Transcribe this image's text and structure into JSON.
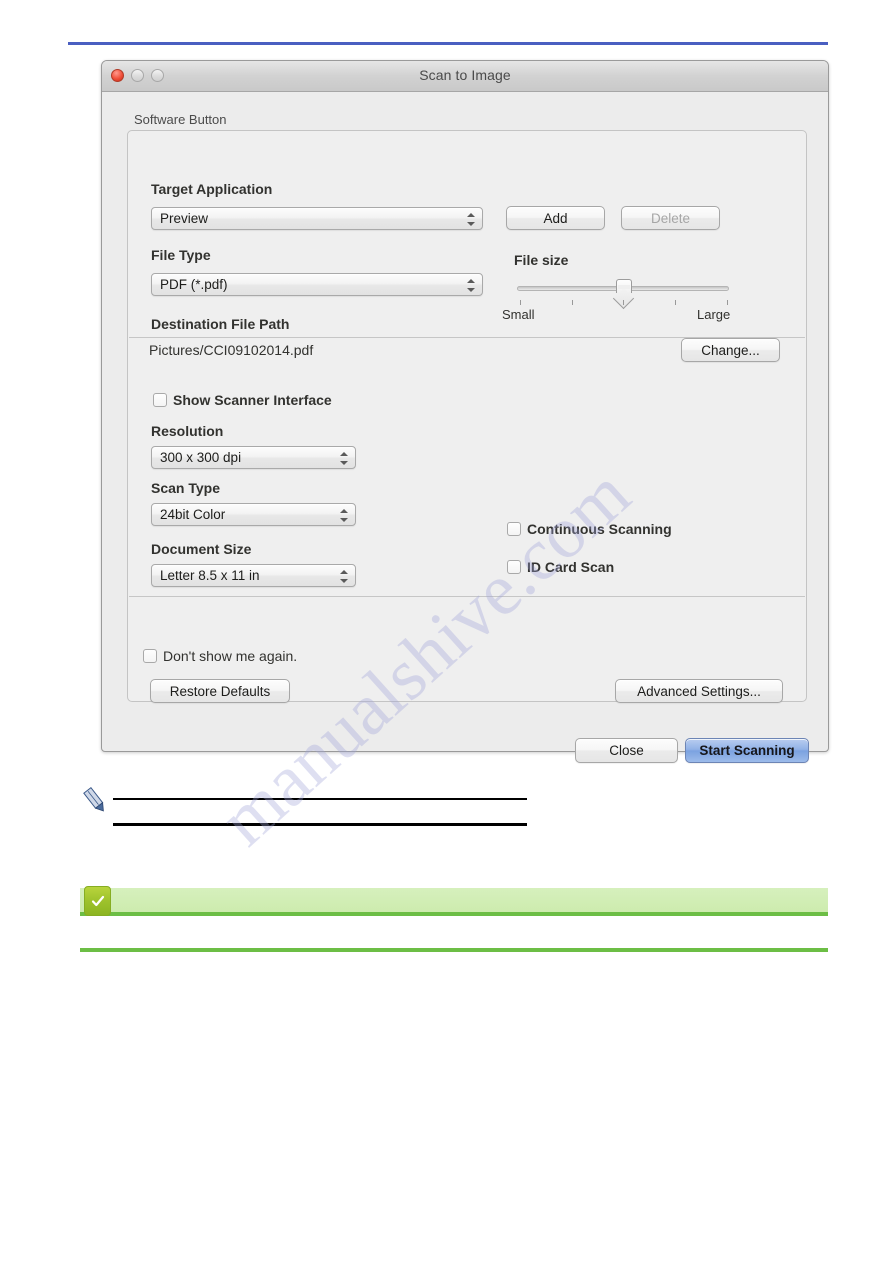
{
  "window": {
    "title": "Scan to Image",
    "traffic_lights": [
      "close-button",
      "minimize-button",
      "maximize-button"
    ]
  },
  "group": {
    "label": "Software Button"
  },
  "target_application": {
    "label": "Target Application",
    "value": "Preview",
    "add_label": "Add",
    "delete_label": "Delete"
  },
  "file_type": {
    "label": "File Type",
    "value": "PDF (*.pdf)"
  },
  "file_size": {
    "label": "File size",
    "small_label": "Small",
    "large_label": "Large",
    "ticks": 5,
    "position": 3
  },
  "destination": {
    "label": "Destination File Path",
    "value": "Pictures/CCI09102014.pdf",
    "change_label": "Change..."
  },
  "show_scanner_interface": {
    "label": "Show Scanner Interface",
    "checked": false
  },
  "resolution": {
    "label": "Resolution",
    "value": "300 x 300 dpi"
  },
  "scan_type": {
    "label": "Scan Type",
    "value": "24bit Color"
  },
  "document_size": {
    "label": "Document Size",
    "value": "Letter 8.5 x 11 in"
  },
  "continuous_scanning": {
    "label": "Continuous Scanning",
    "checked": false
  },
  "id_card_scan": {
    "label": "ID Card Scan",
    "checked": false
  },
  "dont_show": {
    "label": "Don't show me again.",
    "checked": false
  },
  "footer": {
    "restore_defaults_label": "Restore Defaults",
    "advanced_settings_label": "Advanced Settings...",
    "close_label": "Close",
    "start_scanning_label": "Start Scanning"
  },
  "page": {
    "watermark": "manualshive.com",
    "top_rule_color": "#4a5fc1",
    "bottom_rule_color": "#6cbe45",
    "tip_banner_color": "#cdecae"
  }
}
